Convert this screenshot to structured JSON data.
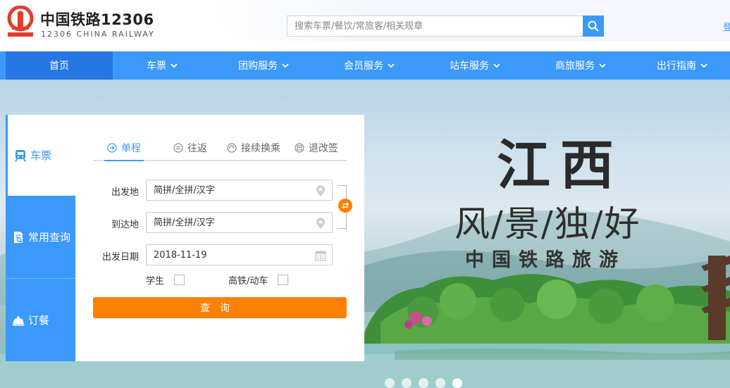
{
  "brand": {
    "name_cn": "中国铁路12306",
    "name_en": "12306 CHINA RAILWAY",
    "logo_icon": "railway-logo-icon",
    "logo_color": "#e53b2c"
  },
  "search": {
    "placeholder": "搜索车票/餐饮/常旅客/相关规章",
    "icon": "search-icon"
  },
  "header_link": "登",
  "nav": {
    "items": [
      {
        "label": "首页",
        "dropdown": false
      },
      {
        "label": "车票",
        "dropdown": true
      },
      {
        "label": "团购服务",
        "dropdown": true
      },
      {
        "label": "会员服务",
        "dropdown": true
      },
      {
        "label": "站车服务",
        "dropdown": true
      },
      {
        "label": "商旅服务",
        "dropdown": true
      },
      {
        "label": "出行指南",
        "dropdown": true
      }
    ],
    "active_index": 0,
    "bg_color": "#3b99fc",
    "active_color": "#2676e3"
  },
  "side_tabs": [
    {
      "label": "车票",
      "icon": "train-icon"
    },
    {
      "label": "常用查询",
      "icon": "query-doc-icon"
    },
    {
      "label": "订餐",
      "icon": "meal-cloche-icon"
    }
  ],
  "booking": {
    "trip_tabs": [
      {
        "label": "单程",
        "icon": "arrow-circle-icon"
      },
      {
        "label": "往返",
        "icon": "equals-circle-icon"
      },
      {
        "label": "接续换乘",
        "icon": "transfer-circle-icon"
      },
      {
        "label": "退改签",
        "icon": "refund-circle-icon"
      }
    ],
    "from_label": "出发地",
    "from_placeholder": "简拼/全拼/汉字",
    "to_label": "到达地",
    "to_placeholder": "简拼/全拼/汉字",
    "date_label": "出发日期",
    "date_value": "2018-11-19",
    "student_label": "学生",
    "highspeed_label": "高铁/动车",
    "submit_label": "查询",
    "accent_color": "#ff8000"
  },
  "banner": {
    "title": "江西",
    "subtitle": "风/景/独/好",
    "tagline": "中国铁路旅游",
    "slides": 5,
    "active_slide": 4
  }
}
